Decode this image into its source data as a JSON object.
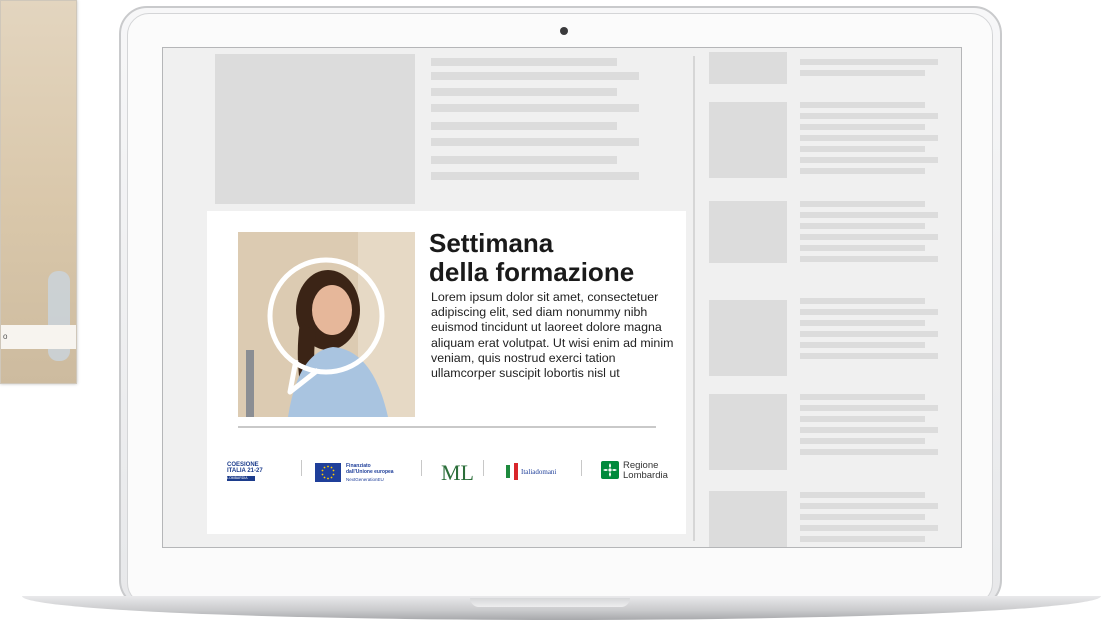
{
  "left_card": {
    "caption": "o"
  },
  "banner": {
    "title_line1": "Settimana",
    "title_line2": "della formazione",
    "body": "Lorem ipsum dolor sit amet, consectetuer adipiscing elit, sed diam nonummy nibh euismod tincidunt ut laoreet dolore magna aliquam erat volutpat.  Ut wisi enim ad minim veniam, quis nostrud exerci tation ullamcorper suscipit lobortis nisl ut"
  },
  "logos": {
    "coesione_line1": "COESIONE",
    "coesione_line2": "ITALIA 21-27",
    "coesione_line3": "LOMBARDIA",
    "eu_line1": "Finanziato",
    "eu_line2": "dall'Unione europea",
    "eu_line3": "NextGenerationEU",
    "italia_domani": "Italiadomani",
    "lombardia_line1": "Regione",
    "lombardia_line2": "Lombardia"
  },
  "colors": {
    "placeholder": "#dcdcdc",
    "screen_bg": "#f0f0f0",
    "eu_blue": "#1f3f9a",
    "lombardia_green": "#008a3c"
  }
}
